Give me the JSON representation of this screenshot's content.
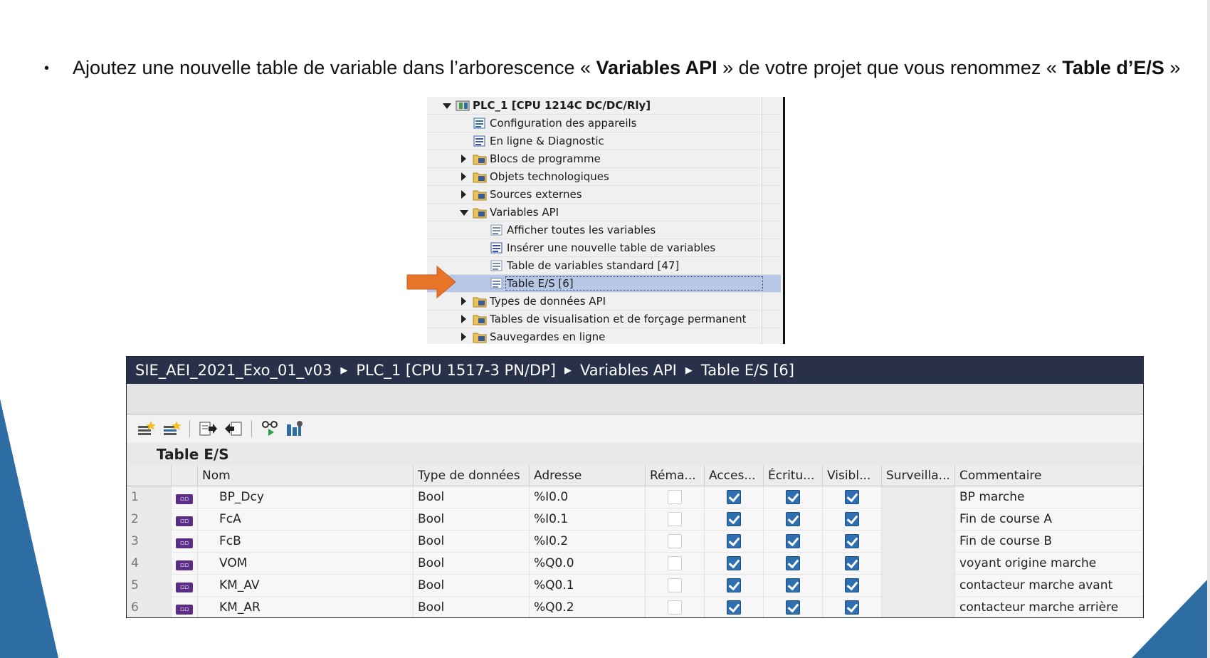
{
  "instruction": {
    "bullet": "•",
    "part1": "Ajoutez une nouvelle table de variable dans l’arborescence « ",
    "bold1": "Variables API",
    "part2": " » de votre projet que vous renommez « ",
    "bold2": "Table d’E/S",
    "part3": " »"
  },
  "tree": {
    "items": [
      {
        "label": "PLC_1 [CPU 1214C DC/DC/Rly]",
        "icon": "plc-icon",
        "expander": "expanded"
      },
      {
        "label": "Configuration des appareils",
        "icon": "device-config-icon",
        "expander": "none"
      },
      {
        "label": "En ligne & Diagnostic",
        "icon": "diagnostic-icon",
        "expander": "none"
      },
      {
        "label": "Blocs de programme",
        "icon": "program-blocks-folder-icon",
        "expander": "collapsed"
      },
      {
        "label": "Objets technologiques",
        "icon": "technology-objects-folder-icon",
        "expander": "collapsed"
      },
      {
        "label": "Sources externes",
        "icon": "external-sources-folder-icon",
        "expander": "collapsed"
      },
      {
        "label": "Variables API",
        "icon": "plc-tags-folder-icon",
        "expander": "expanded"
      },
      {
        "label": "Afficher toutes les variables",
        "icon": "show-all-tags-icon",
        "expander": "none"
      },
      {
        "label": "Insérer une nouvelle table de variables",
        "icon": "add-tag-table-icon",
        "expander": "none"
      },
      {
        "label": "Table de variables standard [47]",
        "icon": "tag-table-icon",
        "expander": "none"
      },
      {
        "label": "Table E/S [6]",
        "icon": "tag-table-icon",
        "expander": "none",
        "selected": true
      },
      {
        "label": "Types de données API",
        "icon": "plc-data-types-folder-icon",
        "expander": "collapsed"
      },
      {
        "label": "Tables de visualisation et de forçage permanent",
        "icon": "watch-tables-folder-icon",
        "expander": "collapsed"
      },
      {
        "label": "Sauvegardes en ligne",
        "icon": "online-backups-folder-icon",
        "expander": "collapsed"
      }
    ]
  },
  "breadcrumb": {
    "items": [
      "SIE_AEI_2021_Exo_01_v03",
      "PLC_1 [CPU 1517-3 PN/DP]",
      "Variables API",
      "Table E/S [6]"
    ]
  },
  "table": {
    "title": "Table E/S",
    "columns": [
      "Nom",
      "Type de données",
      "Adresse",
      "Réma...",
      "Acces...",
      "Écritu...",
      "Visibl...",
      "Surveilla...",
      "Commentaire"
    ],
    "rows": [
      {
        "num": "1",
        "tag": "▫▫",
        "name": "BP_Dcy",
        "type": "Bool",
        "address": "%I0.0",
        "retain": false,
        "access": true,
        "write": true,
        "visible": true,
        "supervision": "",
        "comment": "BP marche"
      },
      {
        "num": "2",
        "tag": "▫▫",
        "name": "FcA",
        "type": "Bool",
        "address": "%I0.1",
        "retain": false,
        "access": true,
        "write": true,
        "visible": true,
        "supervision": "",
        "comment": "Fin de course A"
      },
      {
        "num": "3",
        "tag": "▫▫",
        "name": "FcB",
        "type": "Bool",
        "address": "%I0.2",
        "retain": false,
        "access": true,
        "write": true,
        "visible": true,
        "supervision": "",
        "comment": "Fin de course B"
      },
      {
        "num": "4",
        "tag": "▫▫",
        "name": "VOM",
        "type": "Bool",
        "address": "%Q0.0",
        "retain": false,
        "access": true,
        "write": true,
        "visible": true,
        "supervision": "",
        "comment": "voyant origine marche"
      },
      {
        "num": "5",
        "tag": "▫▫",
        "name": "KM_AV",
        "type": "Bool",
        "address": "%Q0.1",
        "retain": false,
        "access": true,
        "write": true,
        "visible": true,
        "supervision": "",
        "comment": "contacteur marche avant"
      },
      {
        "num": "6",
        "tag": "▫▫",
        "name": "KM_AR",
        "type": "Bool",
        "address": "%Q0.2",
        "retain": false,
        "access": true,
        "write": true,
        "visible": true,
        "supervision": "",
        "comment": "contacteur marche arrière"
      }
    ]
  },
  "toolbar": {
    "buttons": [
      "add-row-icon",
      "insert-row-icon",
      "export-icon",
      "import-icon",
      "monitor-icon",
      "settings-icon"
    ]
  },
  "colors": {
    "accent_blue": "#2e6da4",
    "breadcrumb_bg": "#28304a",
    "arrow_orange": "#e8742a",
    "selection": "#b7c8e6"
  }
}
